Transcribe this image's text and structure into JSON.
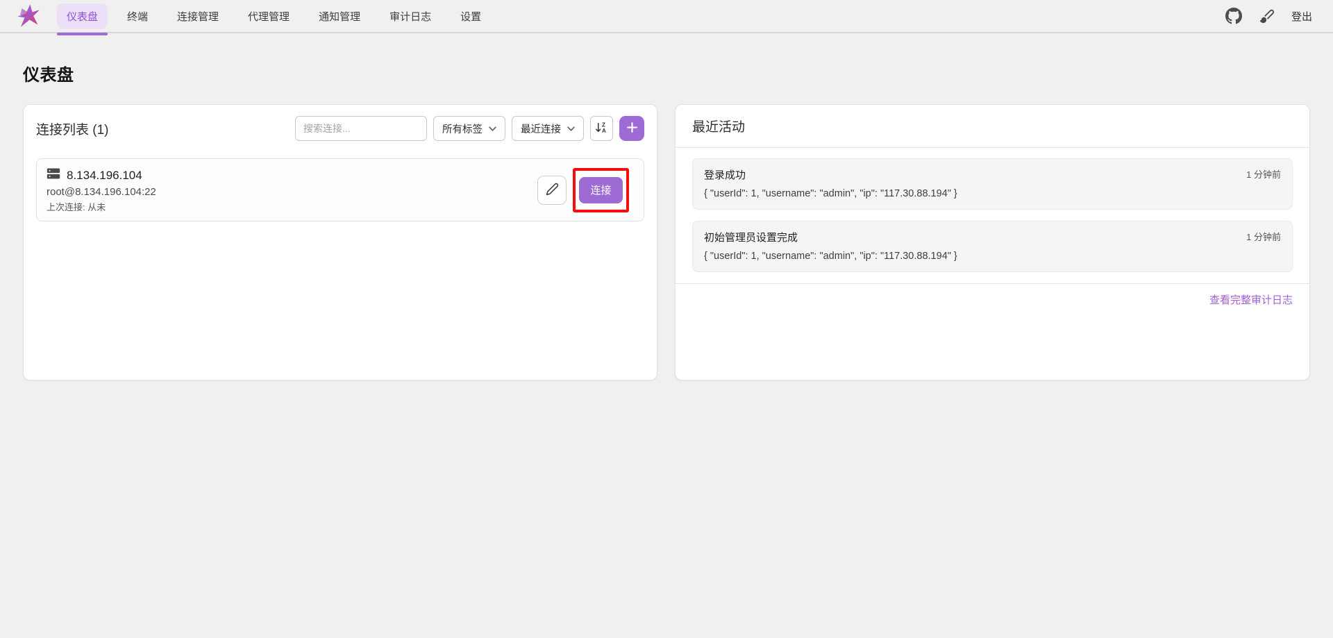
{
  "header": {
    "nav_items": [
      {
        "label": "仪表盘",
        "active": true
      },
      {
        "label": "终端",
        "active": false
      },
      {
        "label": "连接管理",
        "active": false
      },
      {
        "label": "代理管理",
        "active": false
      },
      {
        "label": "通知管理",
        "active": false
      },
      {
        "label": "审计日志",
        "active": false
      },
      {
        "label": "设置",
        "active": false
      }
    ],
    "icons": [
      "app-logo",
      "github-icon",
      "paintbrush-icon"
    ],
    "logout_label": "登出"
  },
  "page": {
    "title": "仪表盘"
  },
  "connections": {
    "title": "连接列表 (1)",
    "search_placeholder": "搜索连接...",
    "tag_filter_value": "所有标签",
    "sort_filter_value": "最近连接",
    "sort_button_icon": "sort-za-icon",
    "add_button_icon": "plus-icon",
    "items": [
      {
        "icon": "server-icon",
        "name": "8.134.196.104",
        "address": "root@8.134.196.104:22",
        "last_connected": "上次连接: 从未",
        "edit_icon": "pencil-icon",
        "connect_label": "连接",
        "highlighted": true
      }
    ]
  },
  "activity": {
    "title": "最近活动",
    "items": [
      {
        "title": "登录成功",
        "time": "1 分钟前",
        "detail": "{ \"userId\": 1, \"username\": \"admin\", \"ip\": \"117.30.88.194\" }"
      },
      {
        "title": "初始管理员设置完成",
        "time": "1 分钟前",
        "detail": "{ \"userId\": 1, \"username\": \"admin\", \"ip\": \"117.30.88.194\" }"
      }
    ],
    "view_all_label": "查看完整审计日志"
  },
  "colors": {
    "accent": "#9e6ad4",
    "accent_light": "#ecdff8",
    "annotation": "#f50d0d",
    "link": "#a35fd8"
  }
}
